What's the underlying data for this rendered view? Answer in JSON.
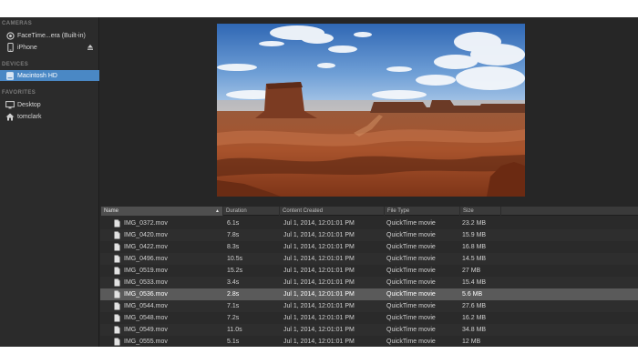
{
  "sidebar": {
    "sections": [
      {
        "title": "CAMERAS",
        "items": [
          {
            "label": "FaceTime...era (Built-in)",
            "icon": "camera-icon"
          },
          {
            "label": "iPhone",
            "icon": "phone-icon",
            "eject": true
          }
        ]
      },
      {
        "title": "DEVICES",
        "items": [
          {
            "label": "Macintosh HD",
            "icon": "hard-drive-icon",
            "selected": true
          }
        ]
      },
      {
        "title": "FAVORITES",
        "items": [
          {
            "label": "Desktop",
            "icon": "desktop-icon"
          },
          {
            "label": "tomclark",
            "icon": "home-icon"
          }
        ]
      }
    ]
  },
  "table": {
    "columns": [
      {
        "label": "Name",
        "sorted": true
      },
      {
        "label": "Duration"
      },
      {
        "label": "Content Created"
      },
      {
        "label": "File Type"
      },
      {
        "label": "Size"
      }
    ],
    "rows": [
      {
        "name": "IMG_0372.mov",
        "duration": "6.1s",
        "created": "Jul 1, 2014, 12:01:01 PM",
        "type": "QuickTime movie",
        "size": "23.2 MB"
      },
      {
        "name": "IMG_0420.mov",
        "duration": "7.8s",
        "created": "Jul 1, 2014, 12:01:01 PM",
        "type": "QuickTime movie",
        "size": "15.9 MB"
      },
      {
        "name": "IMG_0422.mov",
        "duration": "8.3s",
        "created": "Jul 1, 2014, 12:01:01 PM",
        "type": "QuickTime movie",
        "size": "16.8 MB"
      },
      {
        "name": "IMG_0496.mov",
        "duration": "10.5s",
        "created": "Jul 1, 2014, 12:01:01 PM",
        "type": "QuickTime movie",
        "size": "14.5 MB"
      },
      {
        "name": "IMG_0519.mov",
        "duration": "15.2s",
        "created": "Jul 1, 2014, 12:01:01 PM",
        "type": "QuickTime movie",
        "size": "27 MB"
      },
      {
        "name": "IMG_0533.mov",
        "duration": "3.4s",
        "created": "Jul 1, 2014, 12:01:01 PM",
        "type": "QuickTime movie",
        "size": "15.4 MB"
      },
      {
        "name": "IMG_0536.mov",
        "duration": "2.8s",
        "created": "Jul 1, 2014, 12:01:01 PM",
        "type": "QuickTime movie",
        "size": "5.6 MB",
        "selected": true
      },
      {
        "name": "IMG_0544.mov",
        "duration": "7.1s",
        "created": "Jul 1, 2014, 12:01:01 PM",
        "type": "QuickTime movie",
        "size": "27.6 MB"
      },
      {
        "name": "IMG_0548.mov",
        "duration": "7.2s",
        "created": "Jul 1, 2014, 12:01:01 PM",
        "type": "QuickTime movie",
        "size": "16.2 MB"
      },
      {
        "name": "IMG_0549.mov",
        "duration": "11.0s",
        "created": "Jul 1, 2014, 12:01:01 PM",
        "type": "QuickTime movie",
        "size": "34.8 MB"
      },
      {
        "name": "IMG_0555.mov",
        "duration": "5.1s",
        "created": "Jul 1, 2014, 12:01:01 PM",
        "type": "QuickTime movie",
        "size": "12 MB"
      }
    ]
  },
  "colors": {
    "selection_blue": "#4a88c5",
    "selected_row": "#5a5a5a",
    "background": "#282828"
  }
}
